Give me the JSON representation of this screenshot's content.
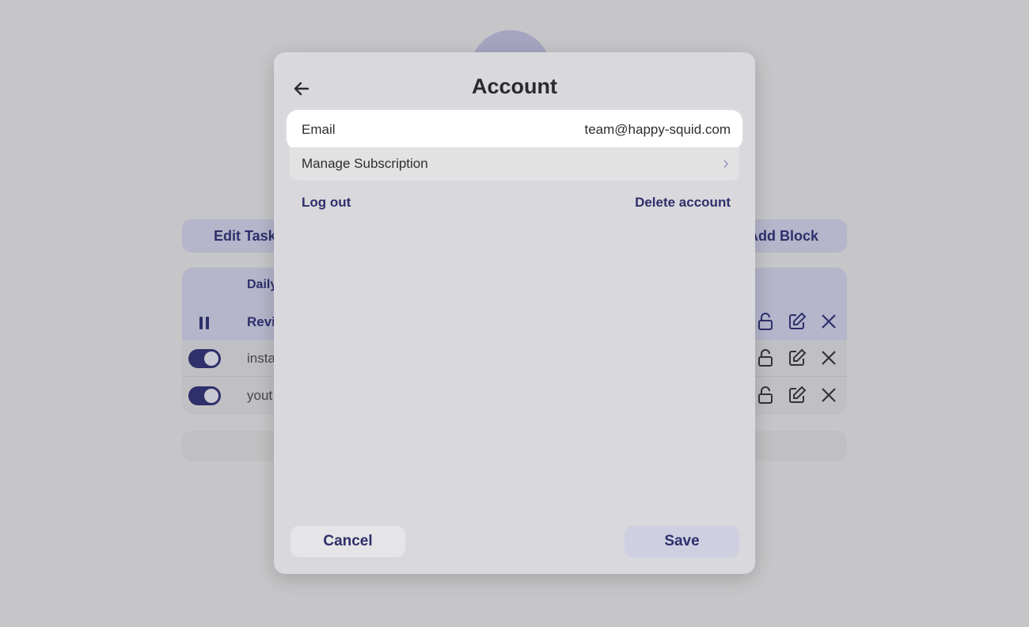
{
  "background": {
    "edit_tasks_label": "Edit Task",
    "add_block_label": "Add Block",
    "section_label": "Daily",
    "task_row_label": "Revi",
    "rows": [
      {
        "label": "insta",
        "enabled": true
      },
      {
        "label": "yout",
        "enabled": true
      }
    ]
  },
  "modal": {
    "title": "Account",
    "email": {
      "label": "Email",
      "value": "team@happy-squid.com"
    },
    "manage_subscription_label": "Manage Subscription",
    "logout_label": "Log out",
    "delete_account_label": "Delete account",
    "cancel_label": "Cancel",
    "save_label": "Save"
  },
  "icons": {
    "back": "arrow-left-icon",
    "chevron": "chevron-right-icon",
    "row_actions": [
      "lock-icon",
      "edit-icon",
      "close-icon"
    ],
    "pause": "pause-icon"
  },
  "colors": {
    "accent": "#2e2f6b",
    "backdrop": "#c6c6c8",
    "modal_bg": "#d8d8dd",
    "save_bg": "#cfcfe2"
  }
}
